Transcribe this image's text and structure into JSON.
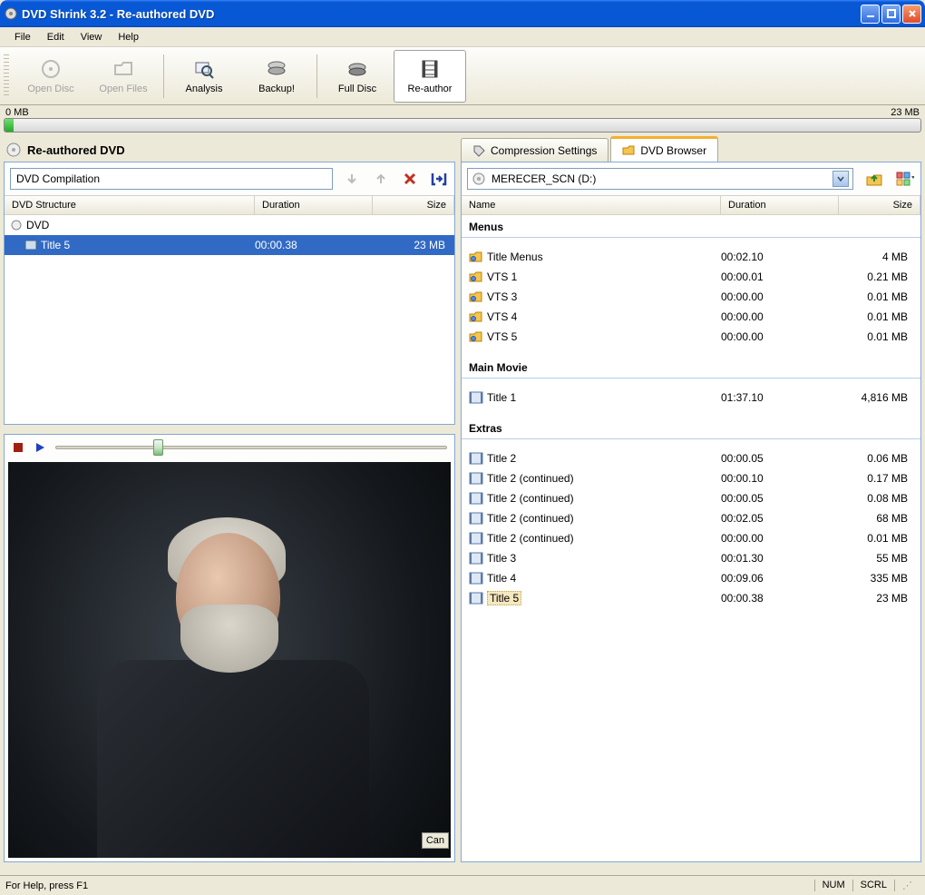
{
  "window": {
    "title": "DVD Shrink 3.2 - Re-authored DVD"
  },
  "menu": {
    "file": "File",
    "edit": "Edit",
    "view": "View",
    "help": "Help"
  },
  "toolbar": {
    "open_disc": "Open Disc",
    "open_files": "Open Files",
    "analysis": "Analysis",
    "backup": "Backup!",
    "full_disc": "Full Disc",
    "reauthor": "Re-author"
  },
  "gauge": {
    "left": "0 MB",
    "right": "23 MB"
  },
  "left": {
    "title": "Re-authored DVD",
    "compilation_name": "DVD Compilation",
    "columns": {
      "structure": "DVD Structure",
      "duration": "Duration",
      "size": "Size"
    },
    "root": {
      "label": "DVD"
    },
    "items": [
      {
        "label": "Title 5",
        "duration": "00:00.38",
        "size": "23 MB"
      }
    ],
    "cancel": "Can"
  },
  "tabs": {
    "compression": "Compression Settings",
    "browser": "DVD Browser"
  },
  "drive": {
    "label": "MERECER_SCN (D:)"
  },
  "browser_columns": {
    "name": "Name",
    "duration": "Duration",
    "size": "Size"
  },
  "groups": {
    "menus": {
      "title": "Menus",
      "items": [
        {
          "name": "Title Menus",
          "duration": "00:02.10",
          "size": "4 MB"
        },
        {
          "name": "VTS 1",
          "duration": "00:00.01",
          "size": "0.21 MB"
        },
        {
          "name": "VTS 3",
          "duration": "00:00.00",
          "size": "0.01 MB"
        },
        {
          "name": "VTS 4",
          "duration": "00:00.00",
          "size": "0.01 MB"
        },
        {
          "name": "VTS 5",
          "duration": "00:00.00",
          "size": "0.01 MB"
        }
      ]
    },
    "main": {
      "title": "Main Movie",
      "items": [
        {
          "name": "Title 1",
          "duration": "01:37.10",
          "size": "4,816 MB"
        }
      ]
    },
    "extras": {
      "title": "Extras",
      "items": [
        {
          "name": "Title 2",
          "duration": "00:00.05",
          "size": "0.06 MB"
        },
        {
          "name": "Title 2 (continued)",
          "duration": "00:00.10",
          "size": "0.17 MB"
        },
        {
          "name": "Title 2 (continued)",
          "duration": "00:00.05",
          "size": "0.08 MB"
        },
        {
          "name": "Title 2 (continued)",
          "duration": "00:02.05",
          "size": "68 MB"
        },
        {
          "name": "Title 2 (continued)",
          "duration": "00:00.00",
          "size": "0.01 MB"
        },
        {
          "name": "Title 3",
          "duration": "00:01.30",
          "size": "55 MB"
        },
        {
          "name": "Title 4",
          "duration": "00:09.06",
          "size": "335 MB"
        },
        {
          "name": "Title 5",
          "duration": "00:00.38",
          "size": "23 MB"
        }
      ]
    }
  },
  "status": {
    "help": "For Help, press F1",
    "num": "NUM",
    "scrl": "SCRL"
  }
}
